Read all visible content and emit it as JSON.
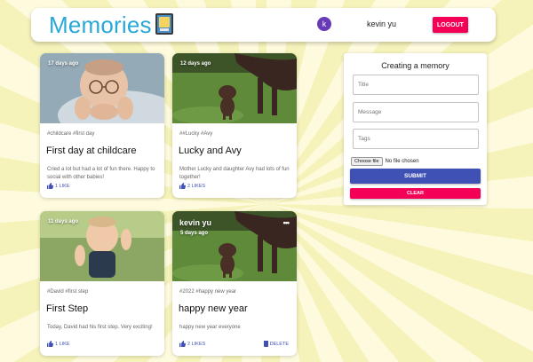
{
  "header": {
    "brand": "Memories",
    "avatar_letter": "k",
    "username": "kevin yu",
    "logout_label": "LOGOUT"
  },
  "posts": [
    {
      "creator": "",
      "time": "17 days ago",
      "tags": "#childcare #first day",
      "title": "First day at childcare",
      "message": "Cried a lot but had a lot of fun there. Happy to social with other babies!",
      "likes": "1 LIKE",
      "image": "baby-with-glasses-photo"
    },
    {
      "creator": "",
      "time": "12 days ago",
      "tags": "##Lucky #Avy",
      "title": "Lucky and Avy",
      "message": "Mother Lucky and daughter Avy had lots of fun together!",
      "likes": "2 LIKES",
      "image": "dogs-on-grass-photo"
    },
    {
      "creator": "",
      "time": "11 days ago",
      "tags": "#David #first step",
      "title": "First Step",
      "message": "Today, David had his first step. Very exciting!",
      "likes": "1 LIKE",
      "image": "toddler-in-overalls-photo"
    },
    {
      "creator": "kevin yu",
      "time": "5 days ago",
      "tags": "#2022 #happy new year",
      "title": "happy new year",
      "message": "happy new year everyone",
      "likes": "2 LIKES",
      "delete_label": "DELETE",
      "more": "•••",
      "image": "dogs-on-grass-photo"
    }
  ],
  "form": {
    "title": "Creating a memory",
    "title_placeholder": "Title",
    "message_placeholder": "Message",
    "tags_placeholder": "Tags",
    "file_button": "Choose file",
    "file_status": "No file chosen",
    "submit_label": "SUBMIT",
    "clear_label": "CLEAR"
  },
  "colors": {
    "brand": "#29a8d8",
    "primary": "#3f51b5",
    "secondary": "#f50057",
    "avatar": "#673ab7"
  }
}
